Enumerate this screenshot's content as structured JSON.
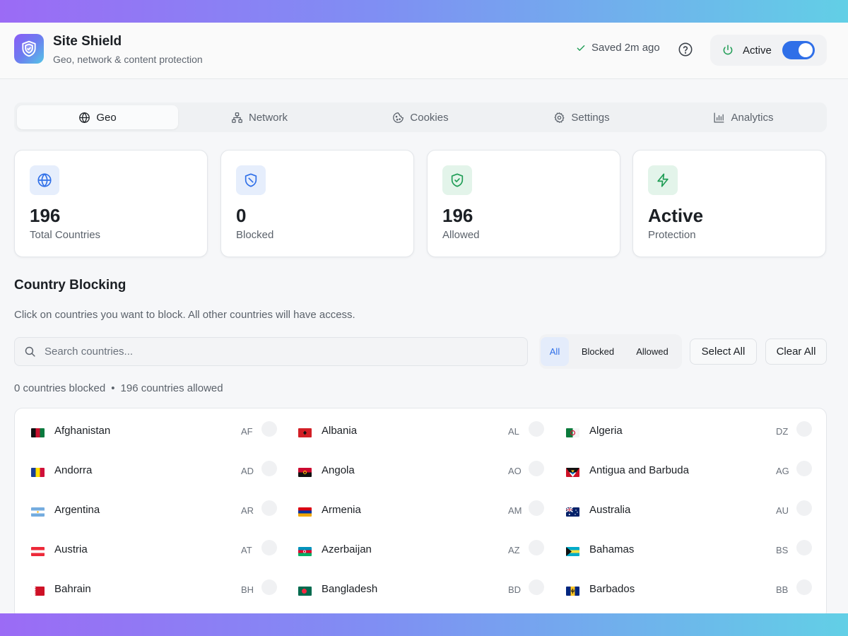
{
  "header": {
    "title": "Site Shield",
    "subtitle": "Geo, network & content protection",
    "saved_text": "Saved 2m ago",
    "status_label": "Active",
    "status_on": true
  },
  "tabs": [
    {
      "label": "Geo",
      "icon": "globe-icon",
      "selected": true
    },
    {
      "label": "Network",
      "icon": "network-icon",
      "selected": false
    },
    {
      "label": "Cookies",
      "icon": "cookie-icon",
      "selected": false
    },
    {
      "label": "Settings",
      "icon": "gear-icon",
      "selected": false
    },
    {
      "label": "Analytics",
      "icon": "bar-chart-icon",
      "selected": false
    }
  ],
  "stats": [
    {
      "value": "196",
      "label": "Total Countries",
      "icon": "globe-icon",
      "color": "#2f6fe8",
      "bg": "#e6eefc"
    },
    {
      "value": "0",
      "label": "Blocked",
      "icon": "shield-off-icon",
      "color": "#2f6fe8",
      "bg": "#e6eefc"
    },
    {
      "value": "196",
      "label": "Allowed",
      "icon": "shield-check-icon",
      "color": "#1f9d55",
      "bg": "#e3f4ea"
    },
    {
      "value": "Active",
      "label": "Protection",
      "icon": "lightning-icon",
      "color": "#1f9d55",
      "bg": "#e3f4ea"
    }
  ],
  "section": {
    "title": "Country Blocking",
    "description": "Click on countries you want to block. All other countries will have access."
  },
  "search": {
    "placeholder": "Search countries...",
    "value": ""
  },
  "filters": [
    {
      "label": "All",
      "selected": true
    },
    {
      "label": "Blocked",
      "selected": false
    },
    {
      "label": "Allowed",
      "selected": false
    }
  ],
  "actions": {
    "select_all": "Select All",
    "clear_all": "Clear All"
  },
  "counts": {
    "blocked_text": "0 countries blocked",
    "separator": "•",
    "allowed_text": "196 countries allowed"
  },
  "countries": [
    {
      "name": "Afghanistan",
      "code": "AF"
    },
    {
      "name": "Albania",
      "code": "AL"
    },
    {
      "name": "Algeria",
      "code": "DZ"
    },
    {
      "name": "Andorra",
      "code": "AD"
    },
    {
      "name": "Angola",
      "code": "AO"
    },
    {
      "name": "Antigua and Barbuda",
      "code": "AG"
    },
    {
      "name": "Argentina",
      "code": "AR"
    },
    {
      "name": "Armenia",
      "code": "AM"
    },
    {
      "name": "Australia",
      "code": "AU"
    },
    {
      "name": "Austria",
      "code": "AT"
    },
    {
      "name": "Azerbaijan",
      "code": "AZ"
    },
    {
      "name": "Bahamas",
      "code": "BS"
    },
    {
      "name": "Bahrain",
      "code": "BH"
    },
    {
      "name": "Bangladesh",
      "code": "BD"
    },
    {
      "name": "Barbados",
      "code": "BB"
    }
  ],
  "colors": {
    "accent": "#2f6fe8",
    "success": "#1f9d55"
  }
}
